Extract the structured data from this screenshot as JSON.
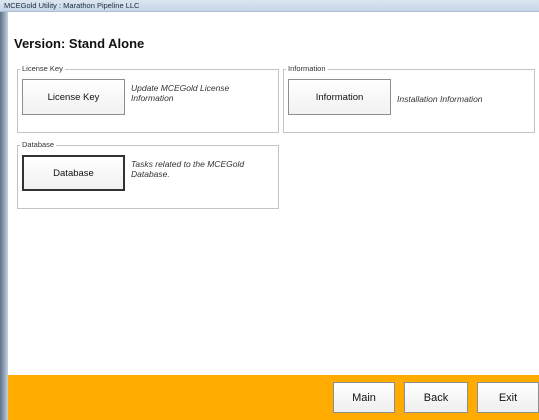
{
  "window": {
    "title": "MCEGold Utility : Marathon Pipeline LLC"
  },
  "header": {
    "version_label": "Version: Stand Alone"
  },
  "license_group": {
    "caption": "License Key",
    "button_label": "License Key",
    "description": "Update MCEGold License Information"
  },
  "info_group": {
    "caption": "Information",
    "button_label": "Information",
    "description": "Installation Information"
  },
  "database_group": {
    "caption": "Database",
    "button_label": "Database",
    "description": "Tasks related to the MCEGold Database."
  },
  "footer": {
    "accent_color": "#ffab00",
    "main_label": "Main",
    "back_label": "Back",
    "exit_label": "Exit"
  }
}
